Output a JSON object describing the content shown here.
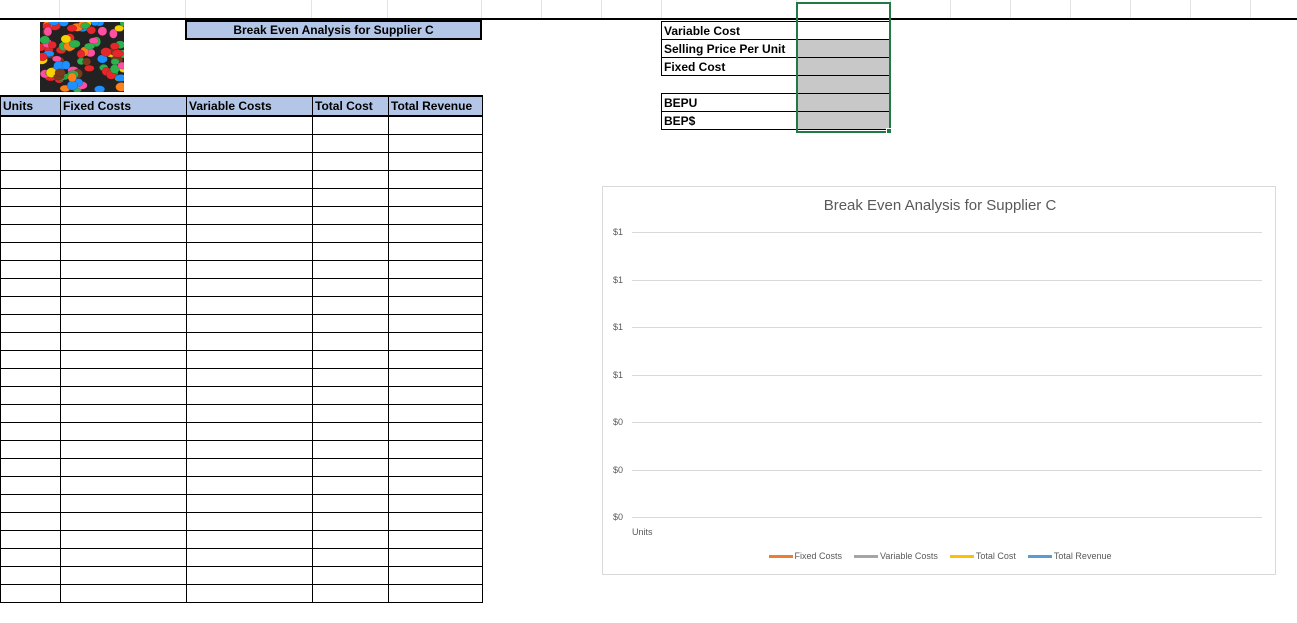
{
  "sheet": {
    "title": "Break Even Analysis for Supplier C",
    "picture_name": "candy-image"
  },
  "table": {
    "headers": [
      "Units",
      "Fixed Costs",
      "Variable Costs",
      "Total Cost",
      "Total Revenue"
    ],
    "row_count": 27
  },
  "inputs": {
    "rows": [
      {
        "label": "Variable Cost",
        "value": ""
      },
      {
        "label": "Selling Price Per Unit",
        "value": ""
      },
      {
        "label": "Fixed Cost",
        "value": ""
      },
      {
        "label": "",
        "value": ""
      },
      {
        "label": "BEPU",
        "value": ""
      },
      {
        "label": "BEP$",
        "value": ""
      }
    ]
  },
  "chart_data": {
    "type": "line",
    "title": "Break Even Analysis for Supplier C",
    "xlabel": "Units",
    "y_tick_labels": [
      "$1",
      "$1",
      "$1",
      "$1",
      "$0",
      "$0",
      "$0"
    ],
    "series": [
      {
        "name": "Fixed Costs",
        "color": "#ed7d31",
        "values": []
      },
      {
        "name": "Variable Costs",
        "color": "#a5a5a5",
        "values": []
      },
      {
        "name": "Total Cost",
        "color": "#ffc000",
        "values": []
      },
      {
        "name": "Total Revenue",
        "color": "#5b9bd5",
        "values": []
      }
    ],
    "grid": true,
    "legend": "bottom"
  }
}
